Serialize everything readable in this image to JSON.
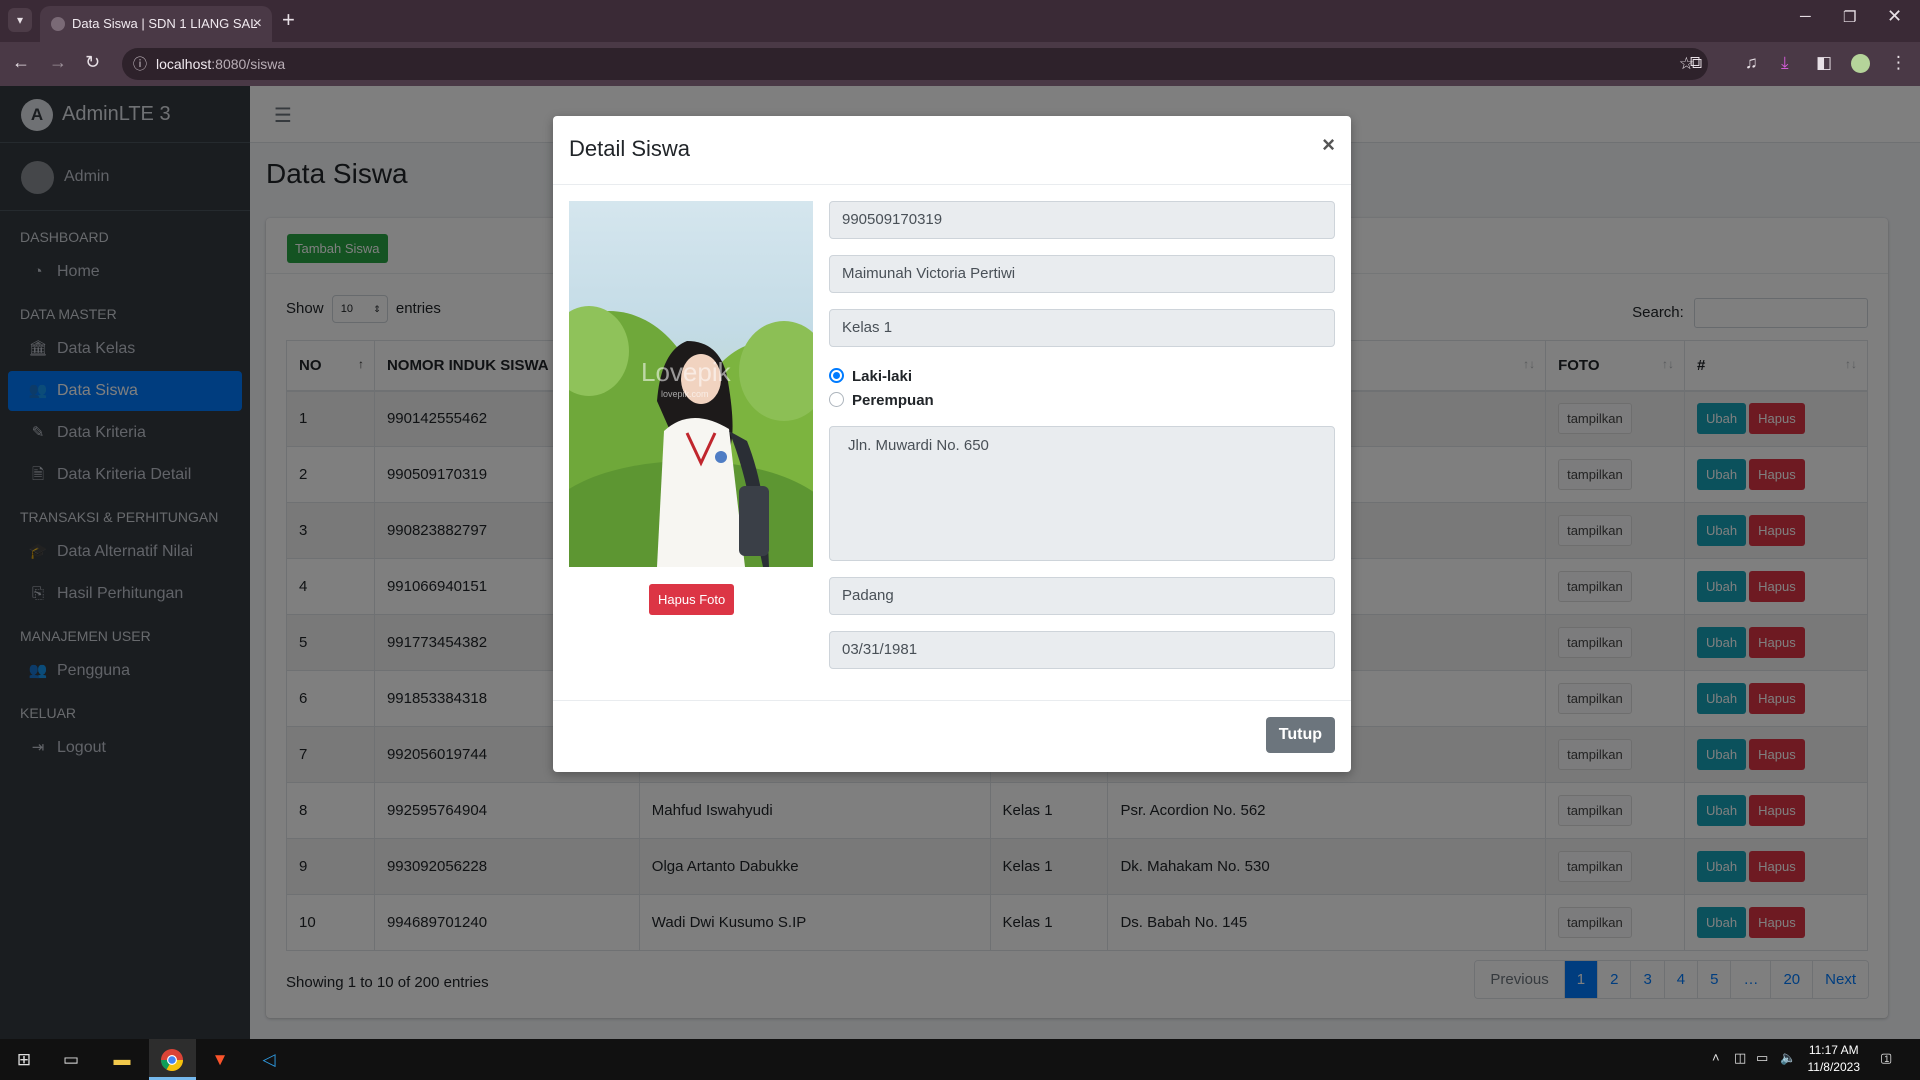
{
  "browser": {
    "tab_title": "Data Siswa | SDN 1 LIANG SAL",
    "url_host": "localhost",
    "url_rest": ":8080/siswa",
    "icons": [
      "tab-list-icon",
      "close-icon",
      "plus-icon",
      "back-icon",
      "forward-icon",
      "reload-icon",
      "info-icon",
      "star-icon",
      "extensions-icon",
      "media-icon",
      "download-icon",
      "sidepanel-icon",
      "profile-icon",
      "menu-icon"
    ]
  },
  "sidebar": {
    "brand": "AdminLTE 3",
    "user": "Admin",
    "sections": [
      {
        "header": "DASHBOARD",
        "items": [
          {
            "label": "Home",
            "icon": "tachometer-icon"
          }
        ]
      },
      {
        "header": "DATA MASTER",
        "items": [
          {
            "label": "Data Kelas",
            "icon": "building-icon"
          },
          {
            "label": "Data Siswa",
            "icon": "users-icon",
            "active": true
          },
          {
            "label": "Data Kriteria",
            "icon": "edit-icon"
          },
          {
            "label": "Data Kriteria Detail",
            "icon": "file-icon"
          }
        ]
      },
      {
        "header": "TRANSAKSI & PERHITUNGAN",
        "items": [
          {
            "label": "Data Alternatif Nilai",
            "icon": "graduation-cap-icon"
          },
          {
            "label": "Hasil Perhitungan",
            "icon": "copy-icon"
          }
        ]
      },
      {
        "header": "MANAJEMEN USER",
        "items": [
          {
            "label": "Pengguna",
            "icon": "users-icon"
          }
        ]
      },
      {
        "header": "KELUAR",
        "items": [
          {
            "label": "Logout",
            "icon": "sign-out-icon"
          }
        ]
      }
    ]
  },
  "page": {
    "title": "Data Siswa",
    "add_button": "Tambah Siswa",
    "show_label": "Show",
    "entries_label": "entries",
    "length_value": "10",
    "search_label": "Search:",
    "columns": [
      "NO",
      "NOMOR INDUK SISWA",
      "",
      "",
      "",
      "FOTO",
      "#"
    ],
    "rows": [
      {
        "no": "1",
        "nis": "990142555462",
        "name": "",
        "kelas": "",
        "alamat": ""
      },
      {
        "no": "2",
        "nis": "990509170319",
        "name": "",
        "kelas": "",
        "alamat": ""
      },
      {
        "no": "3",
        "nis": "990823882797",
        "name": "",
        "kelas": "",
        "alamat": ""
      },
      {
        "no": "4",
        "nis": "991066940151",
        "name": "",
        "kelas": "",
        "alamat": ""
      },
      {
        "no": "5",
        "nis": "991773454382",
        "name": "",
        "kelas": "",
        "alamat": ""
      },
      {
        "no": "6",
        "nis": "991853384318",
        "name": "",
        "kelas": "",
        "alamat": ""
      },
      {
        "no": "7",
        "nis": "992056019744",
        "name": "",
        "kelas": "",
        "alamat": ""
      },
      {
        "no": "8",
        "nis": "992595764904",
        "name": "Mahfud Iswahyudi",
        "kelas": "Kelas 1",
        "alamat": "Psr. Acordion No. 562"
      },
      {
        "no": "9",
        "nis": "993092056228",
        "name": "Olga Artanto Dabukke",
        "kelas": "Kelas 1",
        "alamat": "Dk. Mahakam No. 530"
      },
      {
        "no": "10",
        "nis": "994689701240",
        "name": "Wadi Dwi Kusumo S.IP",
        "kelas": "Kelas 1",
        "alamat": "Ds. Babah No. 145"
      }
    ],
    "tampilkan": "tampilkan",
    "ubah": "Ubah",
    "hapus": "Hapus",
    "showing": "Showing 1 to 10 of 200 entries",
    "pagination": [
      "Previous",
      "1",
      "2",
      "3",
      "4",
      "5",
      "…",
      "20",
      "Next"
    ]
  },
  "modal": {
    "title": "Detail Siswa",
    "close": "×",
    "nis": "990509170319",
    "name": "Maimunah Victoria Pertiwi",
    "kelas": "Kelas 1",
    "gender_male": "Laki-laki",
    "gender_female": "Perempuan",
    "gender_selected": "Laki-laki",
    "alamat": "Jln. Muwardi No. 650",
    "tempat_lahir": "Padang",
    "tanggal_lahir": "03/31/1981",
    "photo_watermark": "Lovepik",
    "photo_watermark_sub": "lovepik.com",
    "hapus_foto": "Hapus Foto",
    "tutup": "Tutup"
  },
  "taskbar": {
    "time": "11:17 AM",
    "date": "11/8/2023",
    "notification_count": "1"
  }
}
